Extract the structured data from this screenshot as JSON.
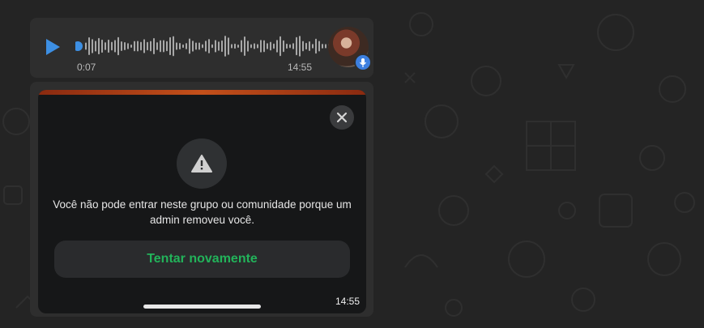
{
  "audio_message": {
    "elapsed": "0:07",
    "timestamp": "14:55"
  },
  "media_message": {
    "error_text": "Você não pode entrar neste grupo ou comunidade porque um admin removeu você.",
    "retry_label": "Tentar novamente",
    "timestamp": "14:55"
  },
  "colors": {
    "accent_blue": "#3d8fe3",
    "retry_green": "#22b35a",
    "background": "#242424",
    "bubble": "#2e2e2e"
  },
  "icons": [
    "play-icon",
    "microphone-icon",
    "close-icon",
    "warning-icon"
  ]
}
